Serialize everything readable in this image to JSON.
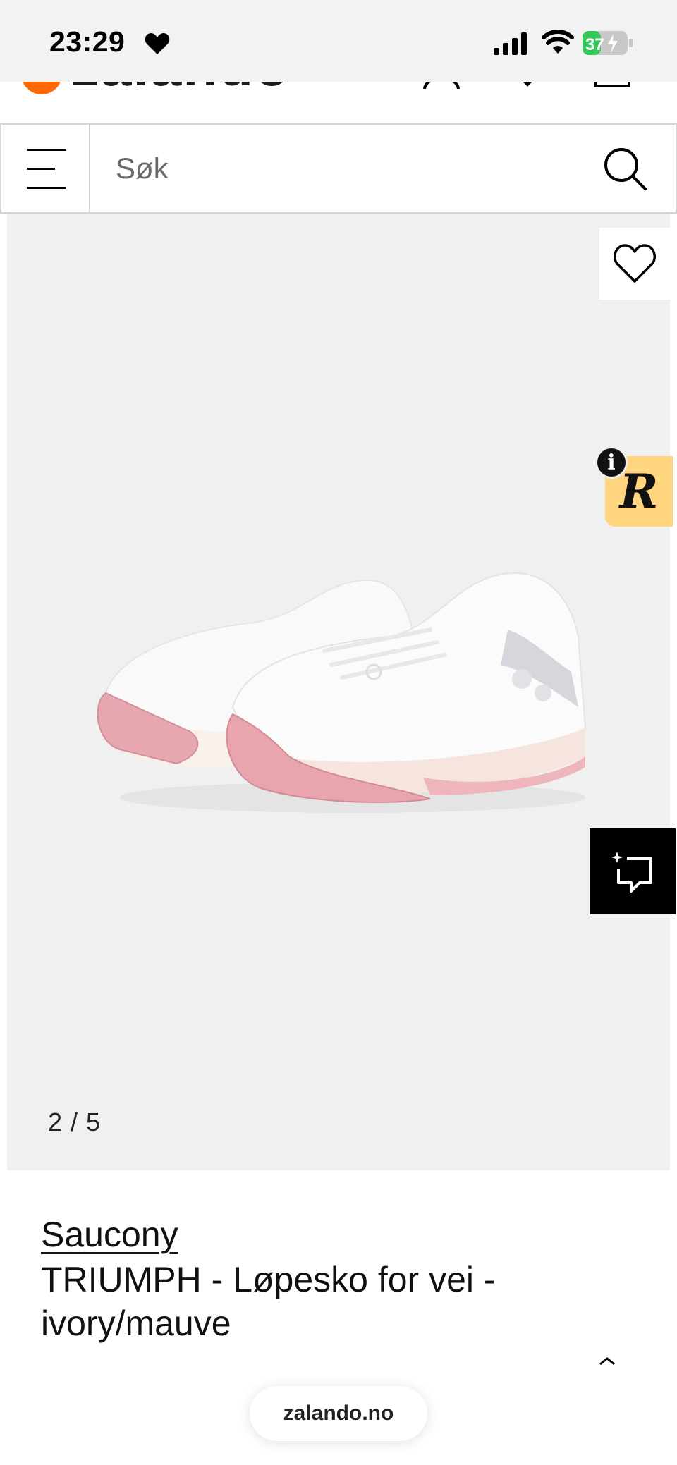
{
  "status_bar": {
    "time": "23:29",
    "battery": "37"
  },
  "header": {
    "logo_text": "zalando"
  },
  "search": {
    "placeholder": "Søk"
  },
  "gallery": {
    "counter": "2 / 5",
    "badge_letter": "R",
    "info_letter": "i"
  },
  "product": {
    "brand": "Saucony",
    "title": "TRIUMPH - Løpesko for vei - ivory/mauve"
  },
  "browser": {
    "url": "zalando.no"
  },
  "colors": {
    "brand_orange": "#ff6900",
    "badge_yellow": "#ffd57f",
    "battery_green": "#34c759",
    "sole_pink": "#e8a5ae"
  },
  "icons": [
    "heart-icon",
    "signal-icon",
    "wifi-icon",
    "battery-icon",
    "menu-icon",
    "search-icon",
    "wishlist-heart-icon",
    "info-icon",
    "compare-icon",
    "chevron-up-icon",
    "user-icon",
    "bag-icon"
  ]
}
